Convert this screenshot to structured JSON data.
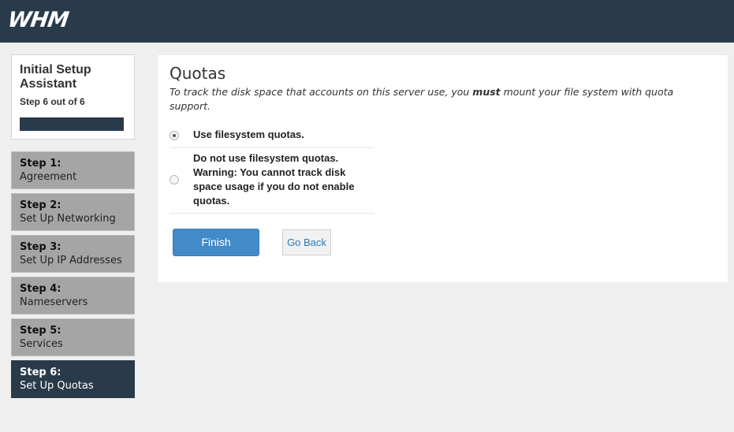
{
  "header": {
    "logo_text": "WHM"
  },
  "colors": {
    "header_bg": "#293a4a",
    "active_step": "#293a4a",
    "inactive_step": "#a5a5a5",
    "primary_button": "#428bca",
    "link": "#2a7ab6"
  },
  "assistant": {
    "title": "Initial Setup Assistant",
    "step_text": "Step 6 out of 6",
    "progress_fraction": 1.0
  },
  "steps": [
    {
      "number": "Step 1:",
      "label": "Agreement",
      "active": false
    },
    {
      "number": "Step 2:",
      "label": "Set Up Networking",
      "active": false
    },
    {
      "number": "Step 3:",
      "label": "Set Up IP Addresses",
      "active": false
    },
    {
      "number": "Step 4:",
      "label": "Nameservers",
      "active": false
    },
    {
      "number": "Step 5:",
      "label": "Services",
      "active": false
    },
    {
      "number": "Step 6:",
      "label": "Set Up Quotas",
      "active": true
    }
  ],
  "main": {
    "title": "Quotas",
    "desc_before": "To track the disk space that accounts on this server use, you ",
    "desc_bold": "must",
    "desc_after": " mount your file system with quota support.",
    "options": [
      {
        "label": "Use filesystem quotas.",
        "selected": true
      },
      {
        "label": "Do not use filesystem quotas. Warning: You cannot track disk space usage if you do not enable quotas.",
        "selected": false
      }
    ],
    "finish_label": "Finish",
    "back_label": "Go Back"
  }
}
